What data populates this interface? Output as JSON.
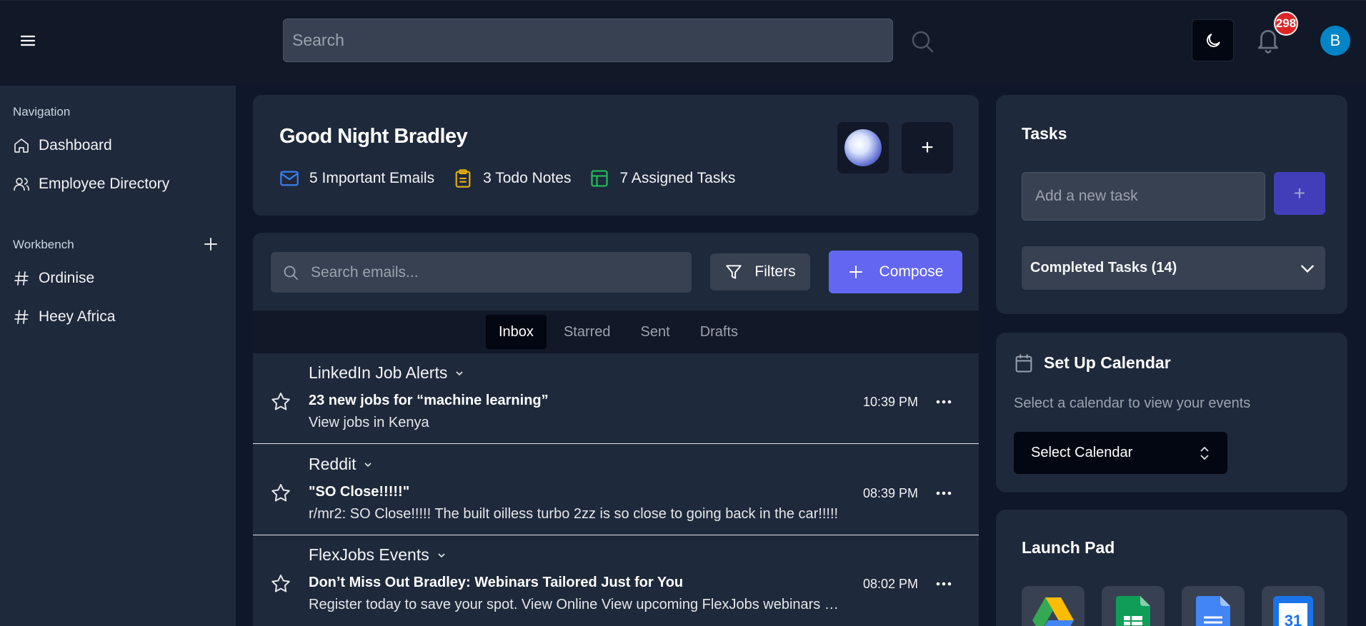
{
  "topbar": {
    "search_placeholder": "Search",
    "notification_count": "298",
    "avatar_initial": "B"
  },
  "sidebar": {
    "navigation_heading": "Navigation",
    "nav_items": [
      {
        "label": "Dashboard",
        "icon": "home-icon"
      },
      {
        "label": "Employee Directory",
        "icon": "users-icon"
      }
    ],
    "workbench_heading": "Workbench",
    "workbench_items": [
      {
        "label": "Ordinise",
        "icon": "hash-icon"
      },
      {
        "label": "Heey Africa",
        "icon": "hash-icon"
      }
    ]
  },
  "greeting": {
    "title": "Good Night Bradley",
    "stats": [
      {
        "label": "5 Important Emails",
        "icon": "mail-icon",
        "color": "#3b82f6"
      },
      {
        "label": "3 Todo Notes",
        "icon": "clipboard-icon",
        "color": "#eab308"
      },
      {
        "label": "7 Assigned Tasks",
        "icon": "layout-icon",
        "color": "#22c55e"
      }
    ],
    "add_label": "+"
  },
  "email": {
    "search_placeholder": "Search emails...",
    "filters_label": "Filters",
    "compose_label": "Compose",
    "tabs": [
      "Inbox",
      "Starred",
      "Sent",
      "Drafts"
    ],
    "active_tab": "Inbox",
    "messages": [
      {
        "sender": "LinkedIn Job Alerts",
        "subject": "23 new jobs for “machine learning”",
        "preview": "View jobs in Kenya",
        "time": "10:39 PM"
      },
      {
        "sender": "Reddit",
        "subject": "\"SO Close!!!!!\"",
        "preview": "r/mr2: SO Close!!!!! The built oilless turbo 2zz is so close to going back in the car!!!!!",
        "time": "08:39 PM"
      },
      {
        "sender": "FlexJobs Events",
        "subject": "Don’t Miss Out Bradley: Webinars Tailored Just for You",
        "preview": "Register today to save your spot. View Online View upcoming FlexJobs webinars and events",
        "time": "08:02 PM"
      }
    ]
  },
  "tasks": {
    "title": "Tasks",
    "input_placeholder": "Add a new task",
    "add_label": "+",
    "completed_label": "Completed Tasks (14)"
  },
  "calendar": {
    "title": "Set Up Calendar",
    "subtitle": "Select a calendar to view your events",
    "select_label": "Select Calendar"
  },
  "launchpad": {
    "title": "Launch Pad",
    "apps": [
      "google-drive-icon",
      "google-sheets-icon",
      "google-docs-icon",
      "google-calendar-icon"
    ],
    "calendar_day": "31"
  },
  "colors": {
    "accent": "#6366f1",
    "background": "#0f172a",
    "card": "#1e293b",
    "badge": "#dc2626"
  }
}
